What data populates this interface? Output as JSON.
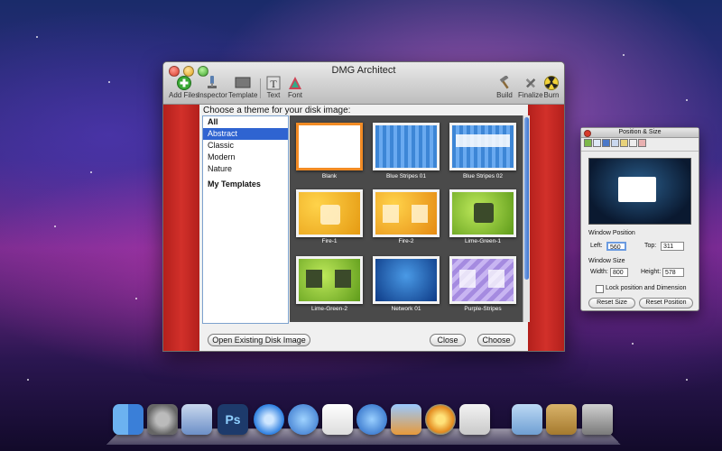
{
  "window": {
    "title": "DMG Architect",
    "toolbar": {
      "add_files": "Add Files",
      "inspector": "Inspector",
      "template": "Template",
      "text": "Text",
      "font": "Font",
      "build": "Build",
      "finalize": "Finalize",
      "burn": "Burn"
    },
    "prompt": "Choose a theme for your disk image:",
    "categories": [
      "All",
      "Abstract",
      "Classic",
      "Modern",
      "Nature",
      "My Templates"
    ],
    "selected_category": "Abstract",
    "themes": [
      "Blank",
      "Blue Stripes 01",
      "Blue Stripes 02",
      "Fire-1",
      "Fire-2",
      "Lime-Green-1",
      "Lime-Green-2",
      "Network 01",
      "Purple-Stripes"
    ],
    "selected_theme": "Blank",
    "buttons": {
      "open_existing": "Open Existing Disk Image ...",
      "close": "Close",
      "choose": "Choose"
    }
  },
  "inspector": {
    "title": "Position & Size",
    "window_position_label": "Window Position",
    "left_label": "Left:",
    "left_value": "560",
    "top_label": "Top:",
    "top_value": "311",
    "window_size_label": "Window Size",
    "width_label": "Width:",
    "width_value": "800",
    "height_label": "Height:",
    "height_value": "578",
    "lock_label": "Lock position and Dimension",
    "reset_size": "Reset Size",
    "reset_position": "Reset Position"
  },
  "dock": {
    "items": [
      "finder-icon",
      "system-preferences-icon",
      "mail-stamp-icon",
      "photoshop-icon",
      "safari-icon",
      "ichat-icon",
      "textedit-icon",
      "itunes-icon",
      "iphoto-icon",
      "dmg-architect-icon",
      "script-editor-icon",
      "folder-icon",
      "address-book-icon",
      "trash-icon"
    ],
    "photoshop_label": "Ps"
  }
}
